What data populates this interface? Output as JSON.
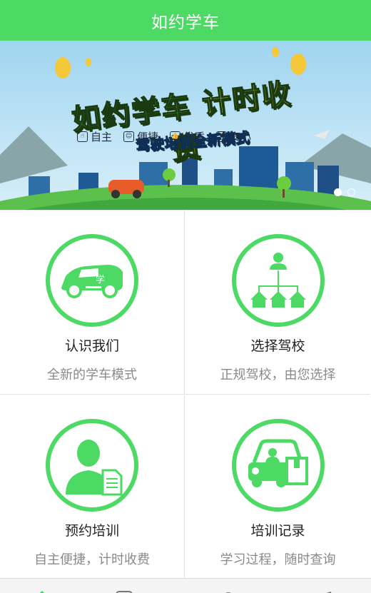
{
  "header": {
    "title": "如约学车"
  },
  "banner": {
    "title_main": "如约学车",
    "title_accent": "计时收费",
    "subtitle_a": "驾驶培训",
    "subtitle_accent": "全新",
    "subtitle_b": "模式",
    "car_label": "学",
    "features": [
      {
        "label": "自主",
        "icon": "hand-icon"
      },
      {
        "label": "便捷",
        "icon": "smile-icon"
      },
      {
        "label": "优质",
        "icon": "thumbs-up-icon"
      },
      {
        "label": "安心",
        "icon": "heart-icon"
      }
    ],
    "carousel": {
      "count": 2,
      "active": 0
    }
  },
  "cards": [
    {
      "title": "认识我们",
      "subtitle": "全新的学车模式",
      "icon": "car-icon",
      "car_label": "学"
    },
    {
      "title": "选择驾校",
      "subtitle": "正规驾校，由您选择",
      "icon": "school-network-icon"
    },
    {
      "title": "预约培训",
      "subtitle": "自主便捷，计时收费",
      "icon": "user-document-icon"
    },
    {
      "title": "培训记录",
      "subtitle": "学习过程，随时查询",
      "icon": "driver-records-icon"
    }
  ],
  "tabbar": {
    "tabs": [
      {
        "icon": "home-icon"
      },
      {
        "icon": "message-icon"
      },
      {
        "icon": "profile-icon"
      },
      {
        "icon": "edit-icon"
      }
    ]
  },
  "colors": {
    "accent": "#4cd964",
    "title_text": "#222222",
    "sub_text": "#8a8a8a"
  }
}
